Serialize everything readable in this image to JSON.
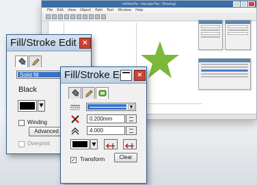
{
  "app": {
    "title": "Untitled.fhx - Inkscape Plus - [Drawing]",
    "menu": [
      "File",
      "Edit",
      "View",
      "Object",
      "Path",
      "Text",
      "Window",
      "Help"
    ],
    "star_color": "#7cb83a"
  },
  "dialog_back": {
    "title": "Fill/Stroke Edit",
    "fill_type": "Solid fill",
    "color_name": "Black",
    "swatch_color": "#000000",
    "winding_label": "Winding",
    "advanced_label": "Advanced",
    "overprint_label": "Overprint"
  },
  "dialog_front": {
    "title": "Fill/Stroke Edit",
    "width_value": "0.200mm",
    "miter_value": "4.000",
    "swatch_color": "#000000",
    "transform_label": "Transform",
    "transform_checked": "✓",
    "clear_label": "Clear"
  },
  "icons": {
    "bucket": "paint-bucket-icon",
    "pencil": "pencil-icon",
    "mixed": "fill-stroke-icon",
    "close": "×"
  }
}
